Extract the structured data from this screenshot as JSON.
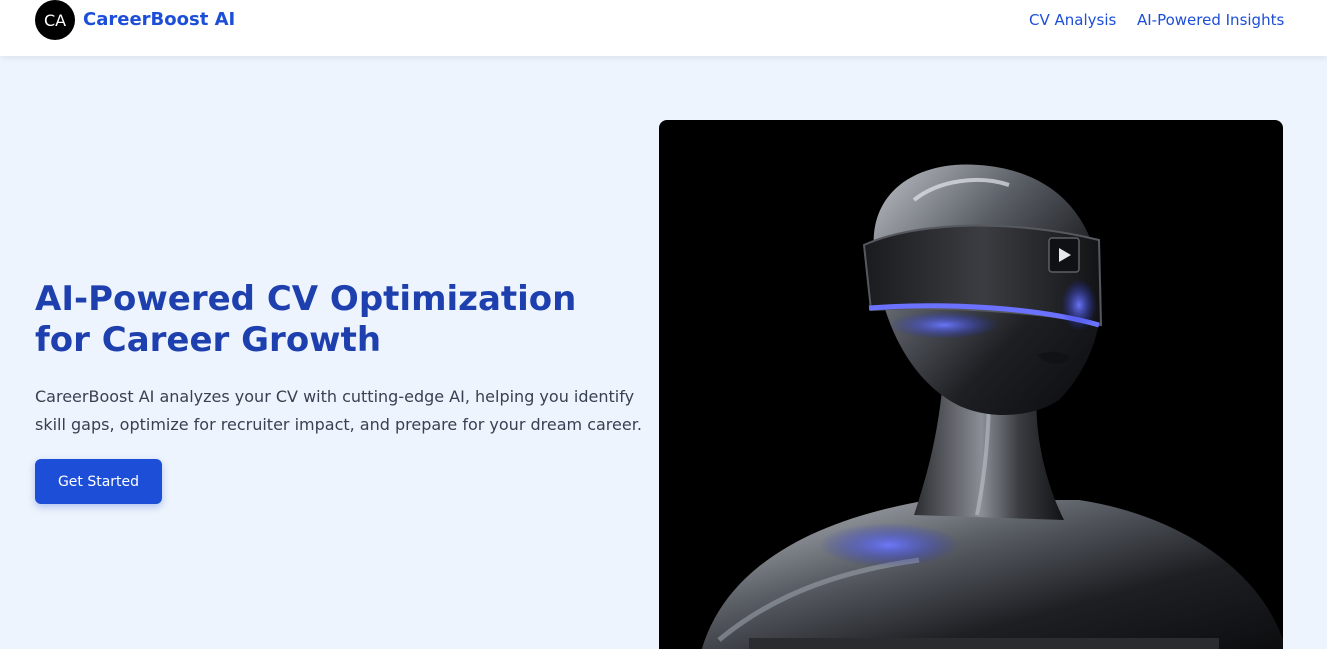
{
  "header": {
    "logo_text": "CA",
    "brand": "CareerBoost AI",
    "nav": [
      {
        "label": "CV Analysis"
      },
      {
        "label": "AI-Powered Insights"
      }
    ]
  },
  "hero": {
    "title": "AI-Powered CV Optimization for Career Growth",
    "description": "CareerBoost AI analyzes your CV with cutting-edge AI, helping you identify skill gaps, optimize for recruiter impact, and prepare for your dream career.",
    "cta_label": "Get Started"
  },
  "media": {
    "subject": "chrome humanoid figure wearing visor",
    "accent_color": "#4f5cf5"
  },
  "colors": {
    "primary": "#1d4ed8",
    "title": "#1e40af",
    "background": "#eef4fd",
    "body_text": "#374151"
  }
}
